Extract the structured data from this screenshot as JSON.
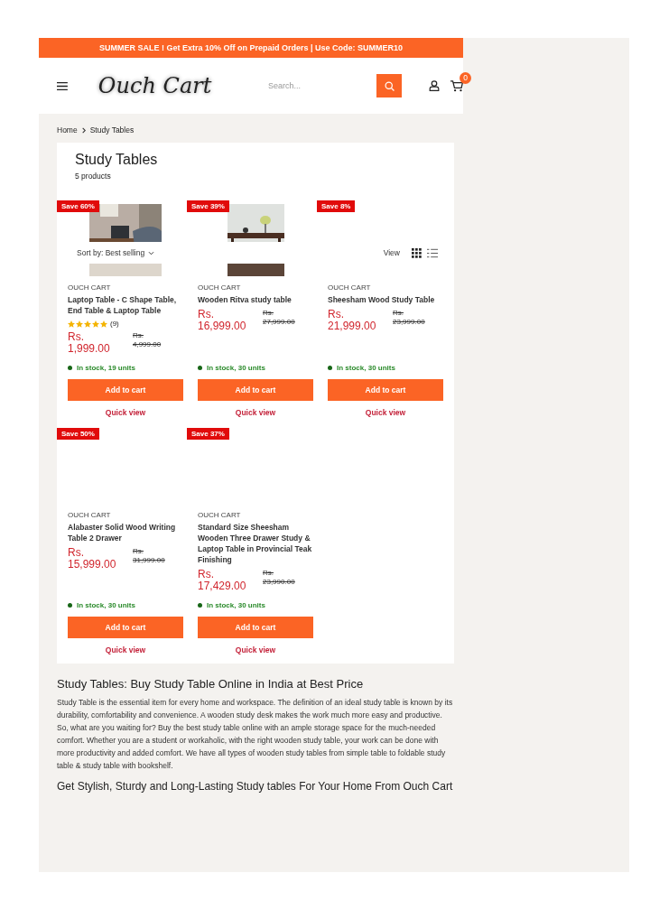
{
  "announcement": "SUMMER SALE ! Get Extra 10% Off on Prepaid Orders | Use Code: SUMMER10",
  "header": {
    "logo": "Ouch Cart",
    "search": {
      "placeholder": "Search..."
    },
    "cart_count": "0"
  },
  "breadcrumb": [
    "Home",
    "Study Tables"
  ],
  "collection": {
    "title": "Study Tables",
    "count": "5 products",
    "toolbar": {
      "sort_label": "Sort by: Best selling",
      "view_label": "View"
    },
    "products": [
      {
        "badge": "Save 60%",
        "kind": "picture",
        "vendor": "OUCH CART",
        "title": "Laptop Table - C Shape Table, End Table & Laptop Table",
        "stars": 5,
        "reviews": "(9)",
        "price": "Rs. 1,999.00",
        "compare": "Rs. 4,999.00",
        "stock": "In stock, 19 units",
        "add": "Add to cart",
        "quick": "Quick view"
      },
      {
        "badge": "Save 39%",
        "kind": "picture",
        "vendor": "OUCH CART",
        "title": "Wooden Ritva study table",
        "price": "Rs. 16,999.00",
        "compare": "Rs. 27,999.00",
        "stock": "In stock, 30 units",
        "add": "Add to cart",
        "quick": "Quick view"
      },
      {
        "badge": "Save 8%",
        "vendor": "OUCH CART",
        "title": "Sheesham Wood Study Table",
        "price": "Rs. 21,999.00",
        "compare": "Rs. 23,999.00",
        "stock": "In stock, 30 units",
        "add": "Add to cart",
        "quick": "Quick view"
      },
      {
        "badge": "Save 50%",
        "vendor": "OUCH CART",
        "title": "Alabaster Solid Wood Writing Table 2 Drawer",
        "price": "Rs. 15,999.00",
        "compare": "Rs. 31,999.00",
        "stock": "In stock, 30 units",
        "add": "Add to cart",
        "quick": "Quick view"
      },
      {
        "badge": "Save 37%",
        "vendor": "OUCH CART",
        "title": "Standard Size Sheesham Wooden Three Drawer Study & Laptop Table in Provincial Teak Finishing",
        "price": "Rs. 17,429.00",
        "compare": "Rs. 23,990.00",
        "stock": "In stock, 30 units",
        "add": "Add to cart",
        "quick": "Quick view"
      }
    ]
  },
  "description": {
    "title": "Study Tables: Buy Study Table Online in India at Best Price",
    "text": "Study Table is the essential item for every home and workspace. The definition of an ideal study table is known by its durability, comfortability and convenience. A wooden study desk makes the work much more easy and productive. So, what are you waiting for? Buy the best study table online with an ample storage space for the much-needed comfort. Whether you are a student or workaholic, with the right wooden study table, your work can be done with more productivity and added comfort. We have all types of wooden study tables from simple table to foldable study table & study table with bookshelf.",
    "subtitle": "Get Stylish, Sturdy and Long-Lasting Study tables For Your Home From Ouch Cart"
  }
}
